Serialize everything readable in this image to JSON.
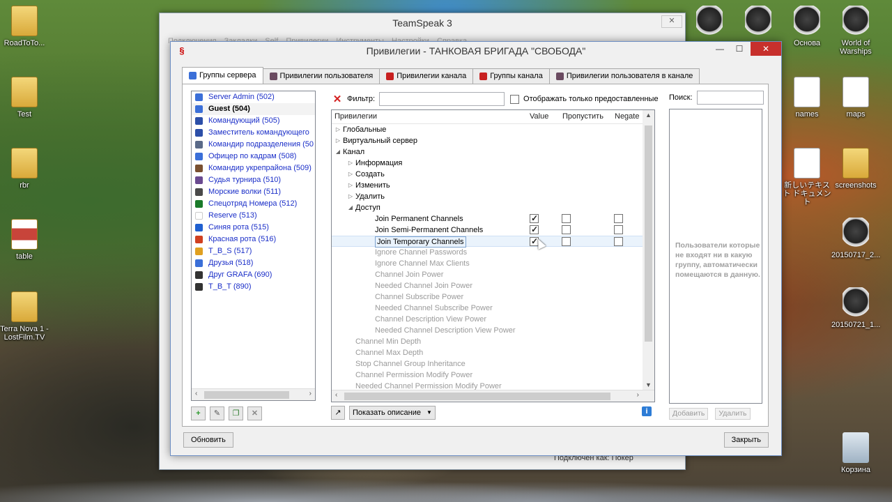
{
  "desktop": {
    "left_icons": [
      {
        "label": "RoadToTo...",
        "kind": "folder"
      },
      {
        "label": "Test",
        "kind": "folder"
      },
      {
        "label": "rbr",
        "kind": "folder"
      },
      {
        "label": "table",
        "kind": "image"
      },
      {
        "label": "Terra Nova 1 - LostFilm.TV",
        "kind": "folder"
      }
    ],
    "right_icons": [
      {
        "label": "Основа",
        "kind": "tank"
      },
      {
        "label": "World of Warships",
        "kind": "tank"
      },
      {
        "label": "names",
        "kind": "doc"
      },
      {
        "label": "maps",
        "kind": "doc"
      },
      {
        "label": "新しいテキスト ドキュメント",
        "kind": "doc"
      },
      {
        "label": "screenshots",
        "kind": "folder"
      },
      {
        "label": "20150717_2...",
        "kind": "tank"
      },
      {
        "label": "20150721_1...",
        "kind": "tank"
      },
      {
        "label": "Корзина",
        "kind": "trash"
      }
    ],
    "behind_text": "Подключен как: Покер"
  },
  "bg_window": {
    "title": "TeamSpeak 3",
    "menu": "Подключения Закладки Self Привилегии Инструменты Настройки Справка"
  },
  "dialog": {
    "title": "Привилегии - ТАНКОВАЯ БРИГАДА \"СВОБОДА\"",
    "tabs": [
      {
        "label": "Группы сервера",
        "active": true
      },
      {
        "label": "Привилегии пользователя"
      },
      {
        "label": "Привилегии канала"
      },
      {
        "label": "Группы канала"
      },
      {
        "label": "Привилегии пользователя в канале"
      }
    ],
    "groups": [
      {
        "label": "Server Admin (502)",
        "color": "#3b6fd8"
      },
      {
        "label": "Guest (504)",
        "color": "#3b6fd8",
        "bold": true
      },
      {
        "label": "Командующий (505)",
        "color": "#2c4fa8"
      },
      {
        "label": "Заместитель командующего",
        "color": "#2c4fa8"
      },
      {
        "label": "Командир подразделения (50",
        "color": "#5a6a88"
      },
      {
        "label": "Офицер по кадрам (508)",
        "color": "#3b6fd8"
      },
      {
        "label": "Командир укрепрайона (509)",
        "color": "#7a5030"
      },
      {
        "label": "Судья турнира (510)",
        "color": "#6a4a90"
      },
      {
        "label": "Морские волки (511)",
        "color": "#4a4a4a"
      },
      {
        "label": "Спецотряд Номера (512)",
        "color": "#1a7a2a"
      },
      {
        "label": "Reserve (513)",
        "color": "#ffffff"
      },
      {
        "label": "Синяя рота (515)",
        "color": "#2060d0"
      },
      {
        "label": "Красная рота (516)",
        "color": "#d04020"
      },
      {
        "label": "T_B_S (517)",
        "color": "#e0a020"
      },
      {
        "label": "Друзья (518)",
        "color": "#3b6fd8"
      },
      {
        "label": "Друг GRAFA (690)",
        "color": "#333333"
      },
      {
        "label": "T_B_T (890)",
        "color": "#333333"
      }
    ],
    "filter_label": "Фильтр:",
    "filter_value": "",
    "show_granted_label": "Отображать только предоставленные",
    "columns": {
      "name": "Привилегии",
      "value": "Value",
      "skip": "Пропустить",
      "negate": "Negate"
    },
    "tree": [
      {
        "label": "Глобальные",
        "level": 0,
        "arrow": "closed"
      },
      {
        "label": "Виртуальный сервер",
        "level": 0,
        "arrow": "closed"
      },
      {
        "label": "Канал",
        "level": 0,
        "arrow": "open"
      },
      {
        "label": "Информация",
        "level": 1,
        "arrow": "closed"
      },
      {
        "label": "Создать",
        "level": 1,
        "arrow": "closed"
      },
      {
        "label": "Изменить",
        "level": 1,
        "arrow": "closed"
      },
      {
        "label": "Удалить",
        "level": 1,
        "arrow": "closed"
      },
      {
        "label": "Доступ",
        "level": 1,
        "arrow": "open"
      },
      {
        "label": "Join Permanent Channels",
        "level": 2,
        "value": true,
        "skip": false,
        "negate": false
      },
      {
        "label": "Join Semi-Permanent Channels",
        "level": 2,
        "value": true,
        "skip": false,
        "negate": false
      },
      {
        "label": "Join Temporary Channels",
        "level": 2,
        "value": true,
        "skip": false,
        "negate": false,
        "selected": true
      },
      {
        "label": "Ignore Channel Passwords",
        "level": 2,
        "dim": true
      },
      {
        "label": "Ignore Channel Max Clients",
        "level": 2,
        "dim": true
      },
      {
        "label": "Channel Join Power",
        "level": 2,
        "dim": true
      },
      {
        "label": "Needed Channel Join Power",
        "level": 2,
        "dim": true
      },
      {
        "label": "Channel Subscribe Power",
        "level": 2,
        "dim": true
      },
      {
        "label": "Needed Channel Subscribe Power",
        "level": 2,
        "dim": true
      },
      {
        "label": "Channel Description View Power",
        "level": 2,
        "dim": true
      },
      {
        "label": "Needed Channel Description View Power",
        "level": 2,
        "dim": true
      },
      {
        "label": "Channel Min Depth",
        "level": 1,
        "dim": true
      },
      {
        "label": "Channel Max Depth",
        "level": 1,
        "dim": true
      },
      {
        "label": "Stop Channel Group Inheritance",
        "level": 1,
        "dim": true
      },
      {
        "label": "Channel Permission Modify Power",
        "level": 1,
        "dim": true
      },
      {
        "label": "Needed Channel Permission Modify Power",
        "level": 1,
        "dim": true
      }
    ],
    "show_description": "Показать описание",
    "search_label": "Поиск:",
    "users_note": "Пользователи которые не входят ни в какую группу, автоматически помещаются в данную.",
    "add_label": "Добавить",
    "remove_label": "Удалить",
    "refresh_label": "Обновить",
    "close_label": "Закрыть"
  }
}
